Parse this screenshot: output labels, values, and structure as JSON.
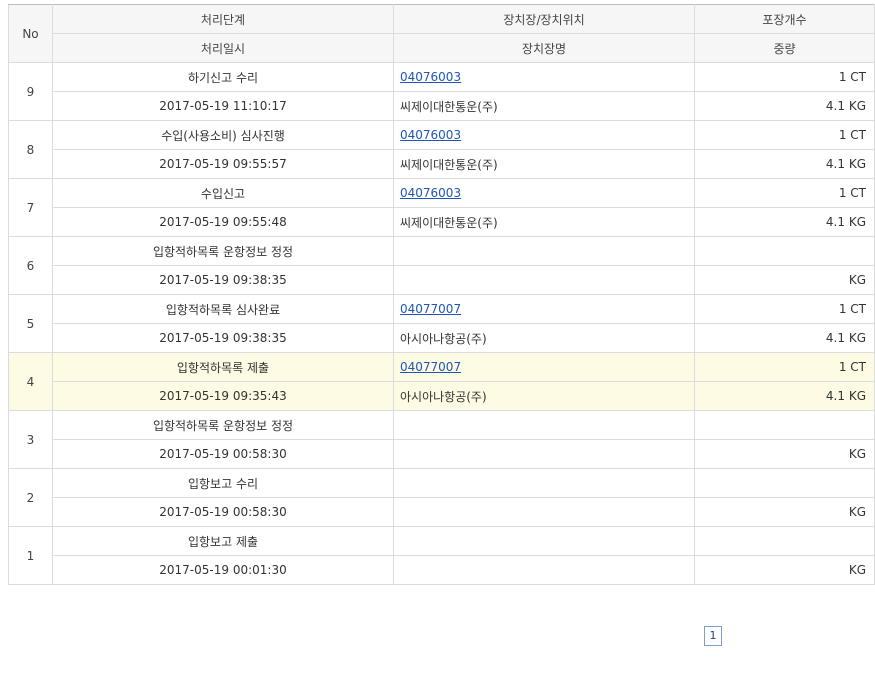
{
  "header": {
    "no": "No",
    "step": "처리단계",
    "location": "장치장/장치위치",
    "packages": "포장개수",
    "datetime": "처리일시",
    "warehouse_name": "장치장명",
    "weight": "중량"
  },
  "rows": [
    {
      "no": "9",
      "step": "하기신고 수리",
      "code": "04076003",
      "packages": "1 CT",
      "datetime": "2017-05-19 11:10:17",
      "warehouse": "씨제이대한통운(주)",
      "weight": "4.1 KG"
    },
    {
      "no": "8",
      "step": "수입(사용소비) 심사진행",
      "code": "04076003",
      "packages": "1 CT",
      "datetime": "2017-05-19 09:55:57",
      "warehouse": "씨제이대한통운(주)",
      "weight": "4.1 KG"
    },
    {
      "no": "7",
      "step": "수입신고",
      "code": "04076003",
      "packages": "1 CT",
      "datetime": "2017-05-19 09:55:48",
      "warehouse": "씨제이대한통운(주)",
      "weight": "4.1 KG"
    },
    {
      "no": "6",
      "step": "입항적하목록 운항정보 정정",
      "code": "",
      "packages": "",
      "datetime": "2017-05-19 09:38:35",
      "warehouse": "",
      "weight": "KG"
    },
    {
      "no": "5",
      "step": "입항적하목록 심사완료",
      "code": "04077007",
      "packages": "1 CT",
      "datetime": "2017-05-19 09:38:35",
      "warehouse": "아시아나항공(주)",
      "weight": "4.1 KG"
    },
    {
      "no": "4",
      "step": "입항적하목록 제출",
      "code": "04077007",
      "packages": "1 CT",
      "datetime": "2017-05-19 09:35:43",
      "warehouse": "아시아나항공(주)",
      "weight": "4.1 KG"
    },
    {
      "no": "3",
      "step": "입항적하목록 운항정보 정정",
      "code": "",
      "packages": "",
      "datetime": "2017-05-19 00:58:30",
      "warehouse": "",
      "weight": "KG"
    },
    {
      "no": "2",
      "step": "입항보고 수리",
      "code": "",
      "packages": "",
      "datetime": "2017-05-19 00:58:30",
      "warehouse": "",
      "weight": "KG"
    },
    {
      "no": "1",
      "step": "입항보고 제출",
      "code": "",
      "packages": "",
      "datetime": "2017-05-19 00:01:30",
      "warehouse": "",
      "weight": "KG"
    }
  ],
  "highlighted_row": "4",
  "pagination": {
    "current": "1"
  }
}
